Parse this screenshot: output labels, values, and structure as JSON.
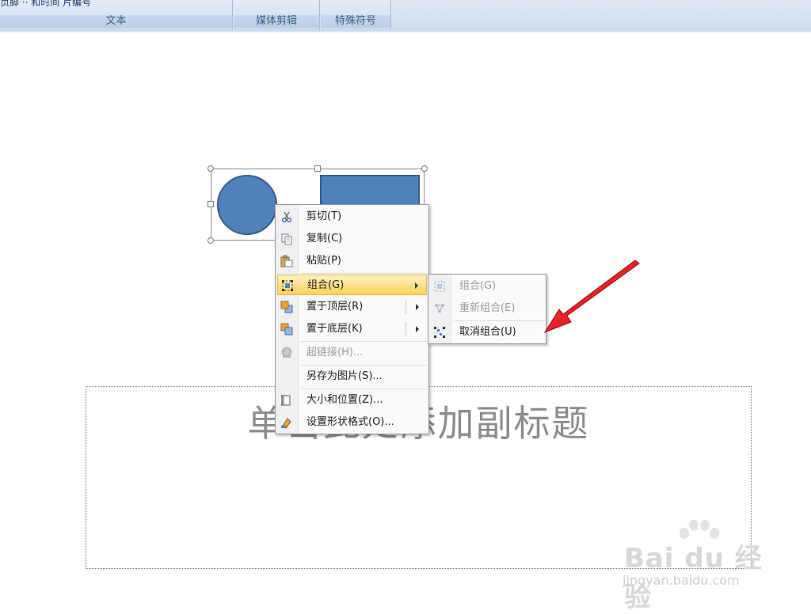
{
  "ribbon": {
    "groups": [
      {
        "top_fragment": "页脚 ·· 和时间 片编号",
        "label": "文本"
      },
      {
        "top_fragment": "",
        "label": "媒体剪辑"
      },
      {
        "top_fragment": "",
        "label": "特殊符号"
      }
    ]
  },
  "slide": {
    "subtitle_placeholder": "单击此处添加副标题",
    "shape_fill": "#4f81bd",
    "shape_border": "#385d8a"
  },
  "context_menu": {
    "items": [
      {
        "label": "剪切(T)",
        "icon": "scissors-icon",
        "enabled": true
      },
      {
        "label": "复制(C)",
        "icon": "copy-icon",
        "enabled": true
      },
      {
        "label": "粘贴(P)",
        "icon": "paste-icon",
        "enabled": true
      },
      {
        "label": "组合(G)",
        "icon": "group-icon",
        "enabled": true,
        "submenu": true,
        "highlighted": true
      },
      {
        "label": "置于顶层(R)",
        "icon": "bring-to-front-icon",
        "enabled": true,
        "submenu": true
      },
      {
        "label": "置于底层(K)",
        "icon": "send-to-back-icon",
        "enabled": true,
        "submenu": true
      },
      {
        "label": "超链接(H)...",
        "icon": "hyperlink-icon",
        "enabled": false
      },
      {
        "label": "另存为图片(S)...",
        "icon": "",
        "enabled": true
      },
      {
        "label": "大小和位置(Z)...",
        "icon": "size-position-icon",
        "enabled": true
      },
      {
        "label": "设置形状格式(O)...",
        "icon": "format-shape-icon",
        "enabled": true
      }
    ]
  },
  "group_submenu": {
    "items": [
      {
        "label": "组合(G)",
        "icon": "group-icon",
        "enabled": false
      },
      {
        "label": "重新组合(E)",
        "icon": "regroup-icon",
        "enabled": false
      },
      {
        "label": "取消组合(U)",
        "icon": "ungroup-icon",
        "enabled": true
      }
    ]
  },
  "watermark": {
    "brand": "Bai du 经验",
    "url": "jingyan.baidu.com"
  },
  "colors": {
    "highlight": "#ffe08a",
    "annotation_arrow": "#e8141b"
  }
}
